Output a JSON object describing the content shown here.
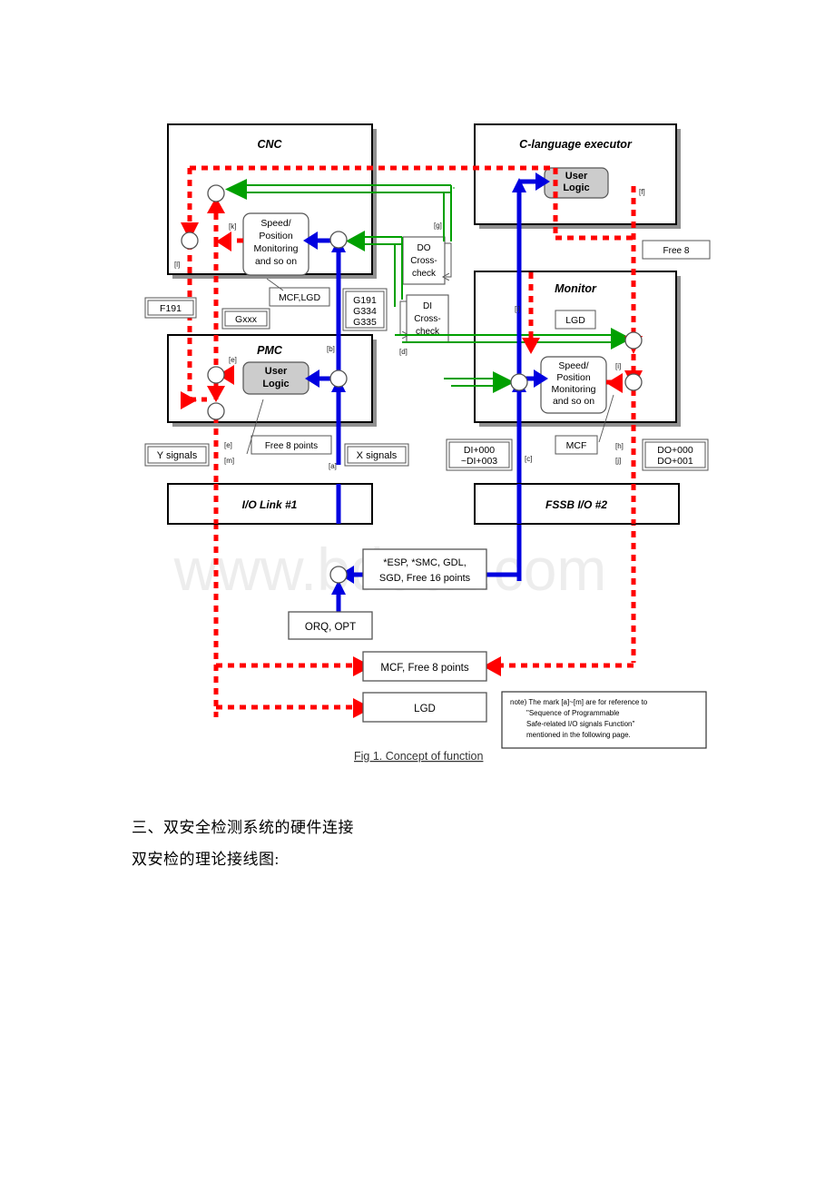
{
  "figure": {
    "caption": "Fig 1. Concept of function",
    "watermark": "www.bdocx.com"
  },
  "blocks": {
    "cnc": {
      "title": "CNC",
      "inner_label": "Speed/\nPosition\nMonitoring\nand so on"
    },
    "c_executor": {
      "title": "C-language executor",
      "inner_label": "User\nLogic"
    },
    "pmc": {
      "title": "PMC",
      "inner_label": "User\nLogic"
    },
    "monitor": {
      "title": "Monitor",
      "inner_label": "Speed/\nPosition\nMonitoring\nand so on",
      "lgd_label": "LGD"
    },
    "io_link": {
      "title": "I/O Link #1"
    },
    "fssb_io": {
      "title": "FSSB I/O #2"
    }
  },
  "crosscheck": {
    "do": "DO\nCross-\ncheck",
    "di": "DI\nCross-\ncheck"
  },
  "labels": {
    "f191": "F191",
    "gxxx": "Gxxx",
    "mcf_lgd": "MCF,LGD",
    "g_group": "G191\nG334\nG335",
    "y_signals": "Y signals",
    "x_signals": "X signals",
    "free_8_points": "Free 8 points",
    "free_8": "Free 8",
    "di_range": "DI+000\n~DI+003",
    "do_range": "DO+000\nDO+001",
    "mcf": "MCF",
    "esp_smc": "*ESP, *SMC, GDL,\nSGD, Free 16 points",
    "orq_opt": "ORQ, OPT",
    "mcf_free8": "MCF, Free 8 points",
    "lgd_bottom": "LGD"
  },
  "markers": {
    "a": "[a]",
    "b": "[b]",
    "c": "[c]",
    "d": "[d]",
    "e": "[e]",
    "f": "[f]",
    "g": "[g]",
    "h": "[h]",
    "i": "[i]",
    "j": "[j]",
    "k": "[k]",
    "l": "[l]",
    "m": "[m]"
  },
  "note": {
    "line1": "note) The mark [a]~[m] are for reference to",
    "line2": "\"Sequence          of          Programmable",
    "line3": "Safe-related    I/O    signals    Function\"",
    "line4": "mentioned in the following page."
  },
  "body_text": {
    "heading": "三、双安全检测系统的硬件连接",
    "subline": "双安检的理论接线图:"
  },
  "colors": {
    "red": "#FF0000",
    "green": "#00A000",
    "blue": "#0000E0",
    "block_fill": "#FFFFFF",
    "inner_fill": "#CCCCCC",
    "shadow": "#808080",
    "border": "#000000",
    "watermark": "#EDEDED"
  }
}
